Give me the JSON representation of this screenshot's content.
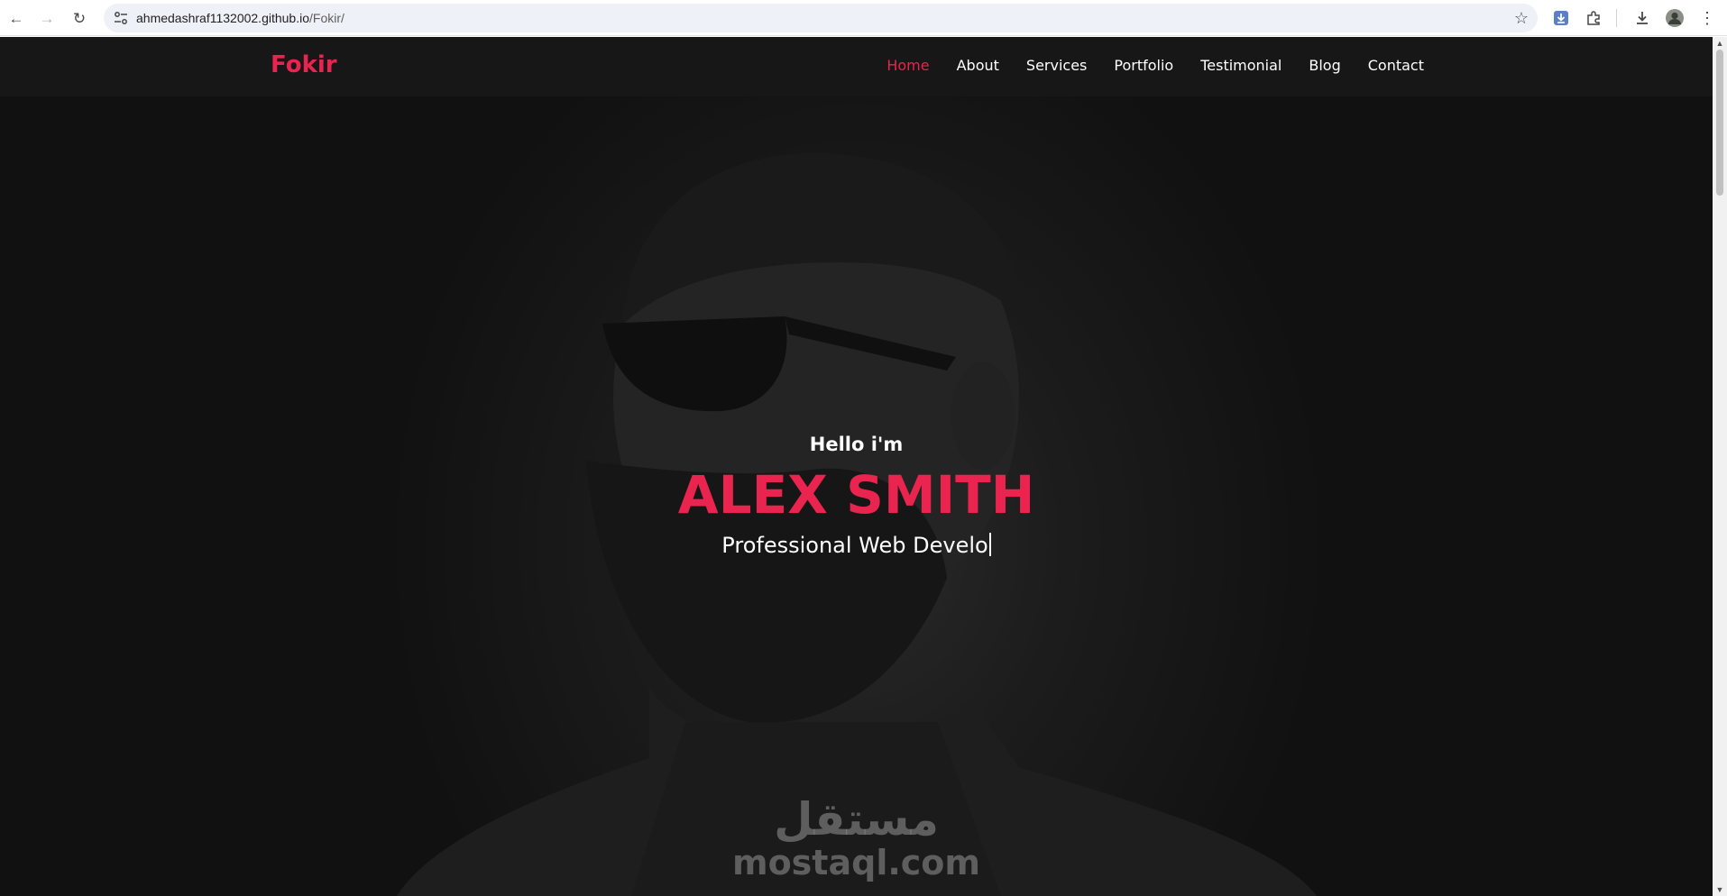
{
  "browser": {
    "url_host": "ahmedashraf1132002.github.io",
    "url_path": "/Fokir/"
  },
  "site": {
    "logo": "Fokir",
    "nav": [
      {
        "label": "Home",
        "active": true
      },
      {
        "label": "About",
        "active": false
      },
      {
        "label": "Services",
        "active": false
      },
      {
        "label": "Portfolio",
        "active": false
      },
      {
        "label": "Testimonial",
        "active": false
      },
      {
        "label": "Blog",
        "active": false
      },
      {
        "label": "Contact",
        "active": false
      }
    ]
  },
  "hero": {
    "greeting": "Hello i'm",
    "name": "ALEX SMITH",
    "role": "Professional Web Develo"
  },
  "watermark": {
    "arabic": "مستقل",
    "latin": "mostaql.com"
  },
  "colors": {
    "accent": "#e8244f",
    "header_bg": "#171717"
  }
}
